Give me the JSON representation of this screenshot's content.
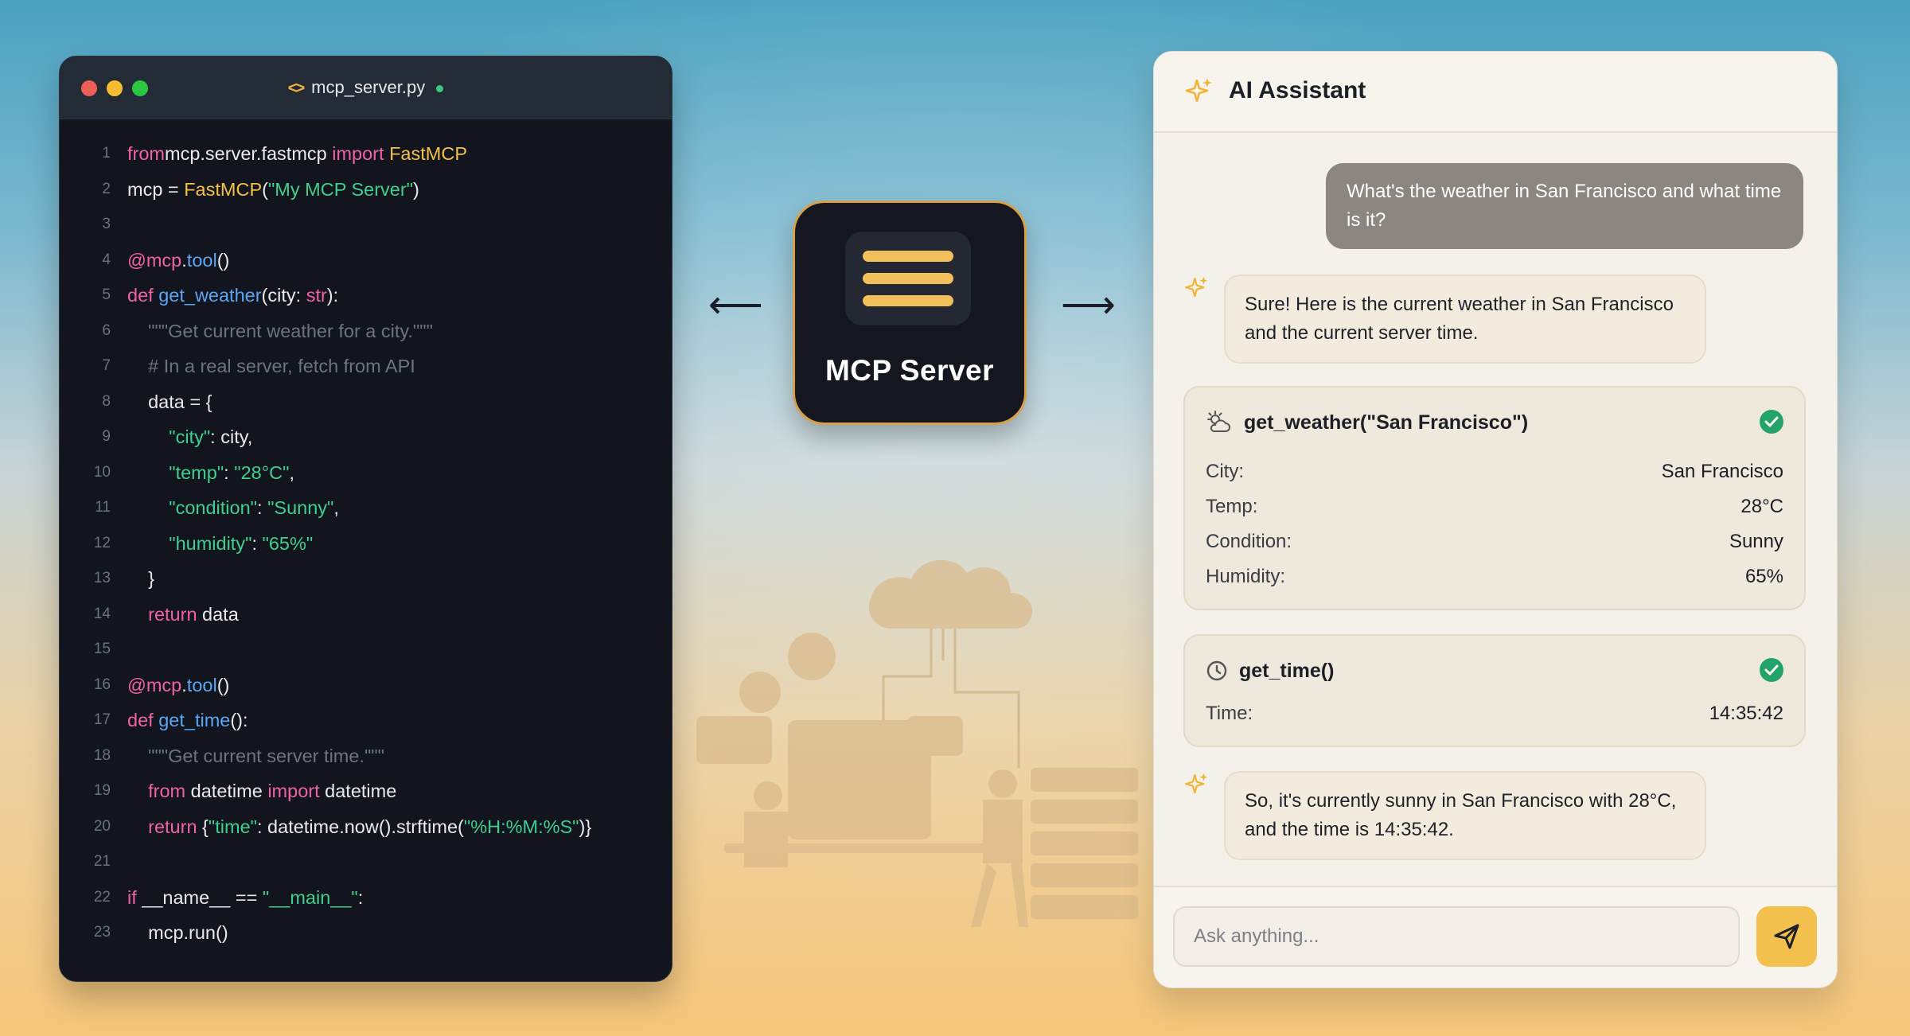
{
  "editor": {
    "filename": "mcp_server.py",
    "lines": [
      {
        "n": "1",
        "segs": [
          [
            "kw",
            "from"
          ],
          [
            "",
            "mcp.server.fastmcp "
          ],
          [
            "kw",
            "import"
          ],
          [
            "",
            " "
          ],
          [
            "cls",
            "FastMCP"
          ]
        ]
      },
      {
        "n": "2",
        "segs": [
          [
            "",
            "mcp = "
          ],
          [
            "cls",
            "FastMCP"
          ],
          [
            "",
            "("
          ],
          [
            "str",
            "\"My MCP Server\""
          ],
          [
            "",
            ")"
          ]
        ]
      },
      {
        "n": "3",
        "segs": []
      },
      {
        "n": "4",
        "segs": [
          [
            "dec",
            "@mcp"
          ],
          [
            "",
            "."
          ],
          [
            "fn",
            "tool"
          ],
          [
            "",
            "()"
          ]
        ]
      },
      {
        "n": "5",
        "segs": [
          [
            "kw",
            "def"
          ],
          [
            "",
            " "
          ],
          [
            "fn",
            "get_weather"
          ],
          [
            "",
            "(city: "
          ],
          [
            "kw",
            "str"
          ],
          [
            "",
            "):"
          ]
        ]
      },
      {
        "n": "6",
        "segs": [
          [
            "cm",
            "    \"\"\"Get current weather for a city.\"\"\""
          ]
        ]
      },
      {
        "n": "7",
        "segs": [
          [
            "cm",
            "    # In a real server, fetch from API"
          ]
        ]
      },
      {
        "n": "8",
        "segs": [
          [
            "",
            "    data = {"
          ]
        ]
      },
      {
        "n": "9",
        "segs": [
          [
            "",
            "        "
          ],
          [
            "str",
            "\"city\""
          ],
          [
            "",
            ": city,"
          ]
        ]
      },
      {
        "n": "10",
        "segs": [
          [
            "",
            "        "
          ],
          [
            "str",
            "\"temp\""
          ],
          [
            "",
            ": "
          ],
          [
            "str",
            "\"28°C\""
          ],
          [
            "",
            ","
          ]
        ]
      },
      {
        "n": "11",
        "segs": [
          [
            "",
            "        "
          ],
          [
            "str",
            "\"condition\""
          ],
          [
            "",
            ": "
          ],
          [
            "str",
            "\"Sunny\""
          ],
          [
            "",
            ","
          ]
        ]
      },
      {
        "n": "12",
        "segs": [
          [
            "",
            "        "
          ],
          [
            "str",
            "\"humidity\""
          ],
          [
            "",
            ": "
          ],
          [
            "str",
            "\"65%\""
          ]
        ]
      },
      {
        "n": "13",
        "segs": [
          [
            "",
            "    }"
          ]
        ]
      },
      {
        "n": "14",
        "segs": [
          [
            "",
            "    "
          ],
          [
            "kw",
            "return"
          ],
          [
            "",
            " data"
          ]
        ]
      },
      {
        "n": "15",
        "segs": []
      },
      {
        "n": "16",
        "segs": [
          [
            "dec",
            "@mcp"
          ],
          [
            "",
            "."
          ],
          [
            "fn",
            "tool"
          ],
          [
            "",
            "()"
          ]
        ]
      },
      {
        "n": "17",
        "segs": [
          [
            "kw",
            "def"
          ],
          [
            "",
            " "
          ],
          [
            "fn",
            "get_time"
          ],
          [
            "",
            "():"
          ]
        ]
      },
      {
        "n": "18",
        "segs": [
          [
            "cm",
            "    \"\"\"Get current server time.\"\"\""
          ]
        ]
      },
      {
        "n": "19",
        "segs": [
          [
            "",
            "    "
          ],
          [
            "kw",
            "from"
          ],
          [
            "",
            " datetime "
          ],
          [
            "kw",
            "import"
          ],
          [
            "",
            " datetime"
          ]
        ]
      },
      {
        "n": "20",
        "segs": [
          [
            "",
            "    "
          ],
          [
            "kw",
            "return"
          ],
          [
            "",
            " {"
          ],
          [
            "str",
            "\"time\""
          ],
          [
            "",
            ": datetime.now().strftime("
          ],
          [
            "str",
            "\"%H:%M:%S\""
          ],
          [
            "",
            ")}"
          ]
        ]
      },
      {
        "n": "21",
        "segs": []
      },
      {
        "n": "22",
        "segs": [
          [
            "kw",
            "if"
          ],
          [
            "",
            " __name__ == "
          ],
          [
            "str",
            "\"__main__\""
          ],
          [
            "",
            ":"
          ]
        ]
      },
      {
        "n": "23",
        "segs": [
          [
            "",
            "    mcp.run()"
          ]
        ]
      }
    ]
  },
  "center": {
    "label": "MCP Server",
    "left_arrow": "⟵",
    "right_arrow": "⟶"
  },
  "chat": {
    "title": "AI Assistant",
    "user_message": "What's the weather in San Francisco and what time is it?",
    "ai_message_1": "Sure! Here is the current weather in San Francisco and the current server time.",
    "weather_tool": {
      "name": "get_weather(\"San Francisco\")",
      "icon": "partly-cloudy-icon",
      "rows": [
        {
          "key": "City:",
          "value": "San Francisco"
        },
        {
          "key": "Temp:",
          "value": "28°C"
        },
        {
          "key": "Condition:",
          "value": "Sunny"
        },
        {
          "key": "Humidity:",
          "value": "65%"
        }
      ]
    },
    "time_tool": {
      "name": "get_time()",
      "icon": "clock-icon",
      "rows": [
        {
          "key": "Time:",
          "value": "14:35:42"
        }
      ]
    },
    "ai_message_2": "So, it's currently sunny in San Francisco with 28°C, and the time is 14:35:42.",
    "input_placeholder": "Ask anything..."
  },
  "colors": {
    "accent": "#f3c04e",
    "success": "#23a36a",
    "editor_bg": "#12151d",
    "chat_bg": "#f4f1ea"
  }
}
